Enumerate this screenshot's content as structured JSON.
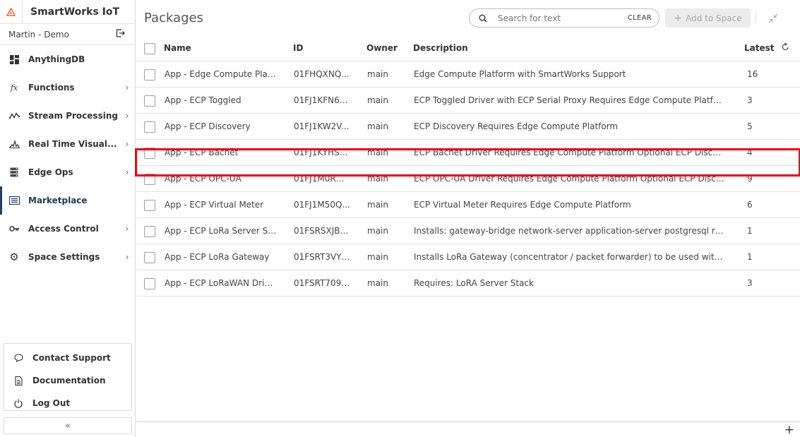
{
  "app": {
    "title": "SmartWorks IoT",
    "accent_color": "#e8000b",
    "brand_color": "#e86a2a",
    "logo_icon": "triangle-logo-icon"
  },
  "space": {
    "name": "Martin - Demo",
    "switch_icon": "exit-icon"
  },
  "nav": [
    {
      "label": "AnythingDB",
      "icon": "grid-icon",
      "has_children": false,
      "active": false
    },
    {
      "label": "Functions",
      "icon": "function-icon",
      "has_children": true,
      "active": false
    },
    {
      "label": "Stream Processing",
      "icon": "stream-icon",
      "has_children": true,
      "active": false
    },
    {
      "label": "Real Time Visual...",
      "icon": "chart-icon",
      "has_children": true,
      "active": false
    },
    {
      "label": "Edge Ops",
      "icon": "server-icon",
      "has_children": true,
      "active": false
    },
    {
      "label": "Marketplace",
      "icon": "list-icon",
      "has_children": false,
      "active": true
    },
    {
      "label": "Access Control",
      "icon": "key-icon",
      "has_children": true,
      "active": false
    },
    {
      "label": "Space Settings",
      "icon": "gear-icon",
      "has_children": true,
      "active": false
    }
  ],
  "bottom": [
    {
      "label": "Contact Support",
      "icon": "chat-icon"
    },
    {
      "label": "Documentation",
      "icon": "document-icon"
    },
    {
      "label": "Log Out",
      "icon": "power-icon"
    }
  ],
  "collapse_label": "«",
  "page": {
    "title": "Packages"
  },
  "search": {
    "placeholder": "Search for text",
    "value": "",
    "clear_label": "CLEAR"
  },
  "toolbar": {
    "add_label": "Add to Space",
    "add_icon": "plus-icon"
  },
  "table": {
    "columns": {
      "name": "Name",
      "id": "ID",
      "owner": "Owner",
      "description": "Description",
      "latest": "Latest"
    },
    "rows": [
      {
        "name": "App - Edge Compute Platf...",
        "id": "01FHQXNQ...",
        "owner": "main",
        "description": "Edge Compute Platform with SmartWorks Support",
        "latest": "16"
      },
      {
        "name": "App - ECP Toggled",
        "id": "01FJ1KFN6C...",
        "owner": "main",
        "description": "ECP Toggled Driver with ECP Serial Proxy Requires Edge Compute Platform",
        "latest": "3"
      },
      {
        "name": "App - ECP Discovery",
        "id": "01FJ1KW2V...",
        "owner": "main",
        "description": "ECP Discovery Requires Edge Compute Platform",
        "latest": "5"
      },
      {
        "name": "App - ECP Bacnet",
        "id": "01FJ1KYHSC...",
        "owner": "main",
        "description": "ECP Bacnet Driver Requires Edge Compute Platform Optional ECP Discovery",
        "latest": "4"
      },
      {
        "name": "App - ECP OPC-UA",
        "id": "01FJ1M0RG...",
        "owner": "main",
        "description": "ECP OPC-UA Driver Requires Edge Compute Platform Optional ECP Discovery",
        "latest": "9"
      },
      {
        "name": "App - ECP Virtual Meter",
        "id": "01FJ1M50Q...",
        "owner": "main",
        "description": "ECP Virtual Meter Requires Edge Compute Platform",
        "latest": "6"
      },
      {
        "name": "App - ECP LoRa Server Sta...",
        "id": "01FSRSXJBF...",
        "owner": "main",
        "description": "Installs: gateway-bridge network-server application-server postgresql redis ...",
        "latest": "1"
      },
      {
        "name": "App - ECP LoRa Gateway",
        "id": "01FSRT3VY8...",
        "owner": "main",
        "description": "Installs LoRa Gateway (concentrator / packet forwarder) to be used with LoR...",
        "latest": "1"
      },
      {
        "name": "App - ECP LoRaWAN Driver",
        "id": "01FSRT7091...",
        "owner": "main",
        "description": "Requires: LoRA Server Stack",
        "latest": "3"
      }
    ]
  },
  "footer": {
    "add_label": "+"
  }
}
